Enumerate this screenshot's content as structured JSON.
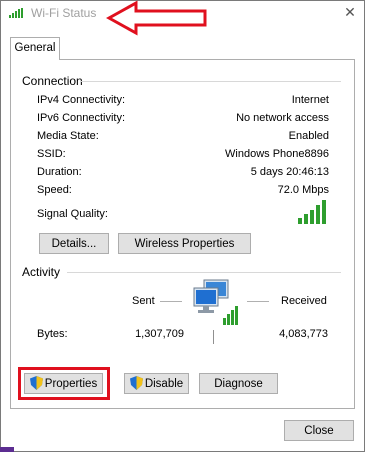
{
  "window": {
    "title": "Wi-Fi Status",
    "close_glyph": "✕"
  },
  "tabs": [
    {
      "label": "General"
    }
  ],
  "connection": {
    "heading": "Connection",
    "rows": [
      {
        "label": "IPv4 Connectivity:",
        "value": "Internet"
      },
      {
        "label": "IPv6 Connectivity:",
        "value": "No network access"
      },
      {
        "label": "Media State:",
        "value": "Enabled"
      },
      {
        "label": "SSID:",
        "value": "Windows Phone8896"
      },
      {
        "label": "Duration:",
        "value": "5 days 20:46:13"
      },
      {
        "label": "Speed:",
        "value": "72.0 Mbps"
      }
    ],
    "signal_label": "Signal Quality:",
    "signal_bars_lit": 5,
    "signal_bars_total": 5
  },
  "buttons": {
    "details": "Details...",
    "wireless_properties": "Wireless Properties",
    "properties": "Properties",
    "disable": "Disable",
    "diagnose": "Diagnose",
    "close": "Close"
  },
  "activity": {
    "heading": "Activity",
    "sent_label": "Sent",
    "received_label": "Received",
    "bytes_label": "Bytes:",
    "bytes_sent": "1,307,709",
    "bytes_received": "4,083,773"
  },
  "colors": {
    "annotation_red": "#e0101e",
    "signal_green": "#2e9e2e",
    "accent_blue": "#1f6fd1"
  }
}
